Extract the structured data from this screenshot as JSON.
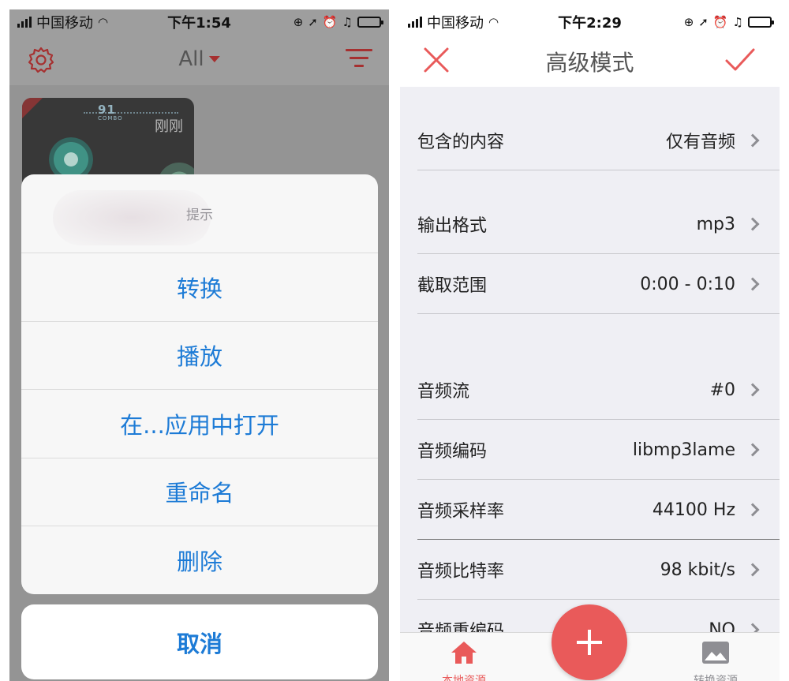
{
  "left": {
    "statusbar": {
      "carrier": "中国移动",
      "time": "下午1:54"
    },
    "navbar": {
      "title": "All"
    },
    "thumbnail": {
      "score": "91",
      "combo": "COMBO",
      "time_label": "刚刚"
    },
    "sheet": {
      "title": "提示",
      "items": [
        "转换",
        "播放",
        "在...应用中打开",
        "重命名",
        "删除"
      ],
      "cancel": "取消"
    },
    "icons": {
      "settings": "gear-icon",
      "filter": "filter-icon"
    }
  },
  "right": {
    "statusbar": {
      "carrier": "中国移动",
      "time": "下午2:29"
    },
    "navbar": {
      "title": "高级模式"
    },
    "settings": [
      {
        "label": "包含的内容",
        "value": "仅有音频"
      },
      {
        "label": "输出格式",
        "value": "mp3"
      },
      {
        "label": "截取范围",
        "value": "0:00 - 0:10"
      },
      {
        "label": "音频流",
        "value": "#0"
      },
      {
        "label": "音频编码",
        "value": "libmp3lame"
      },
      {
        "label": "音频采样率",
        "value": "44100 Hz"
      },
      {
        "label": "音频比特率",
        "value": "98 kbit/s"
      },
      {
        "label": "音频重编码",
        "value": "NO"
      }
    ],
    "tabbar": {
      "home_label": "本地资源",
      "media_label": "转换资源"
    },
    "colors": {
      "accent": "#e95a5a",
      "link": "#1d7bd6"
    }
  }
}
